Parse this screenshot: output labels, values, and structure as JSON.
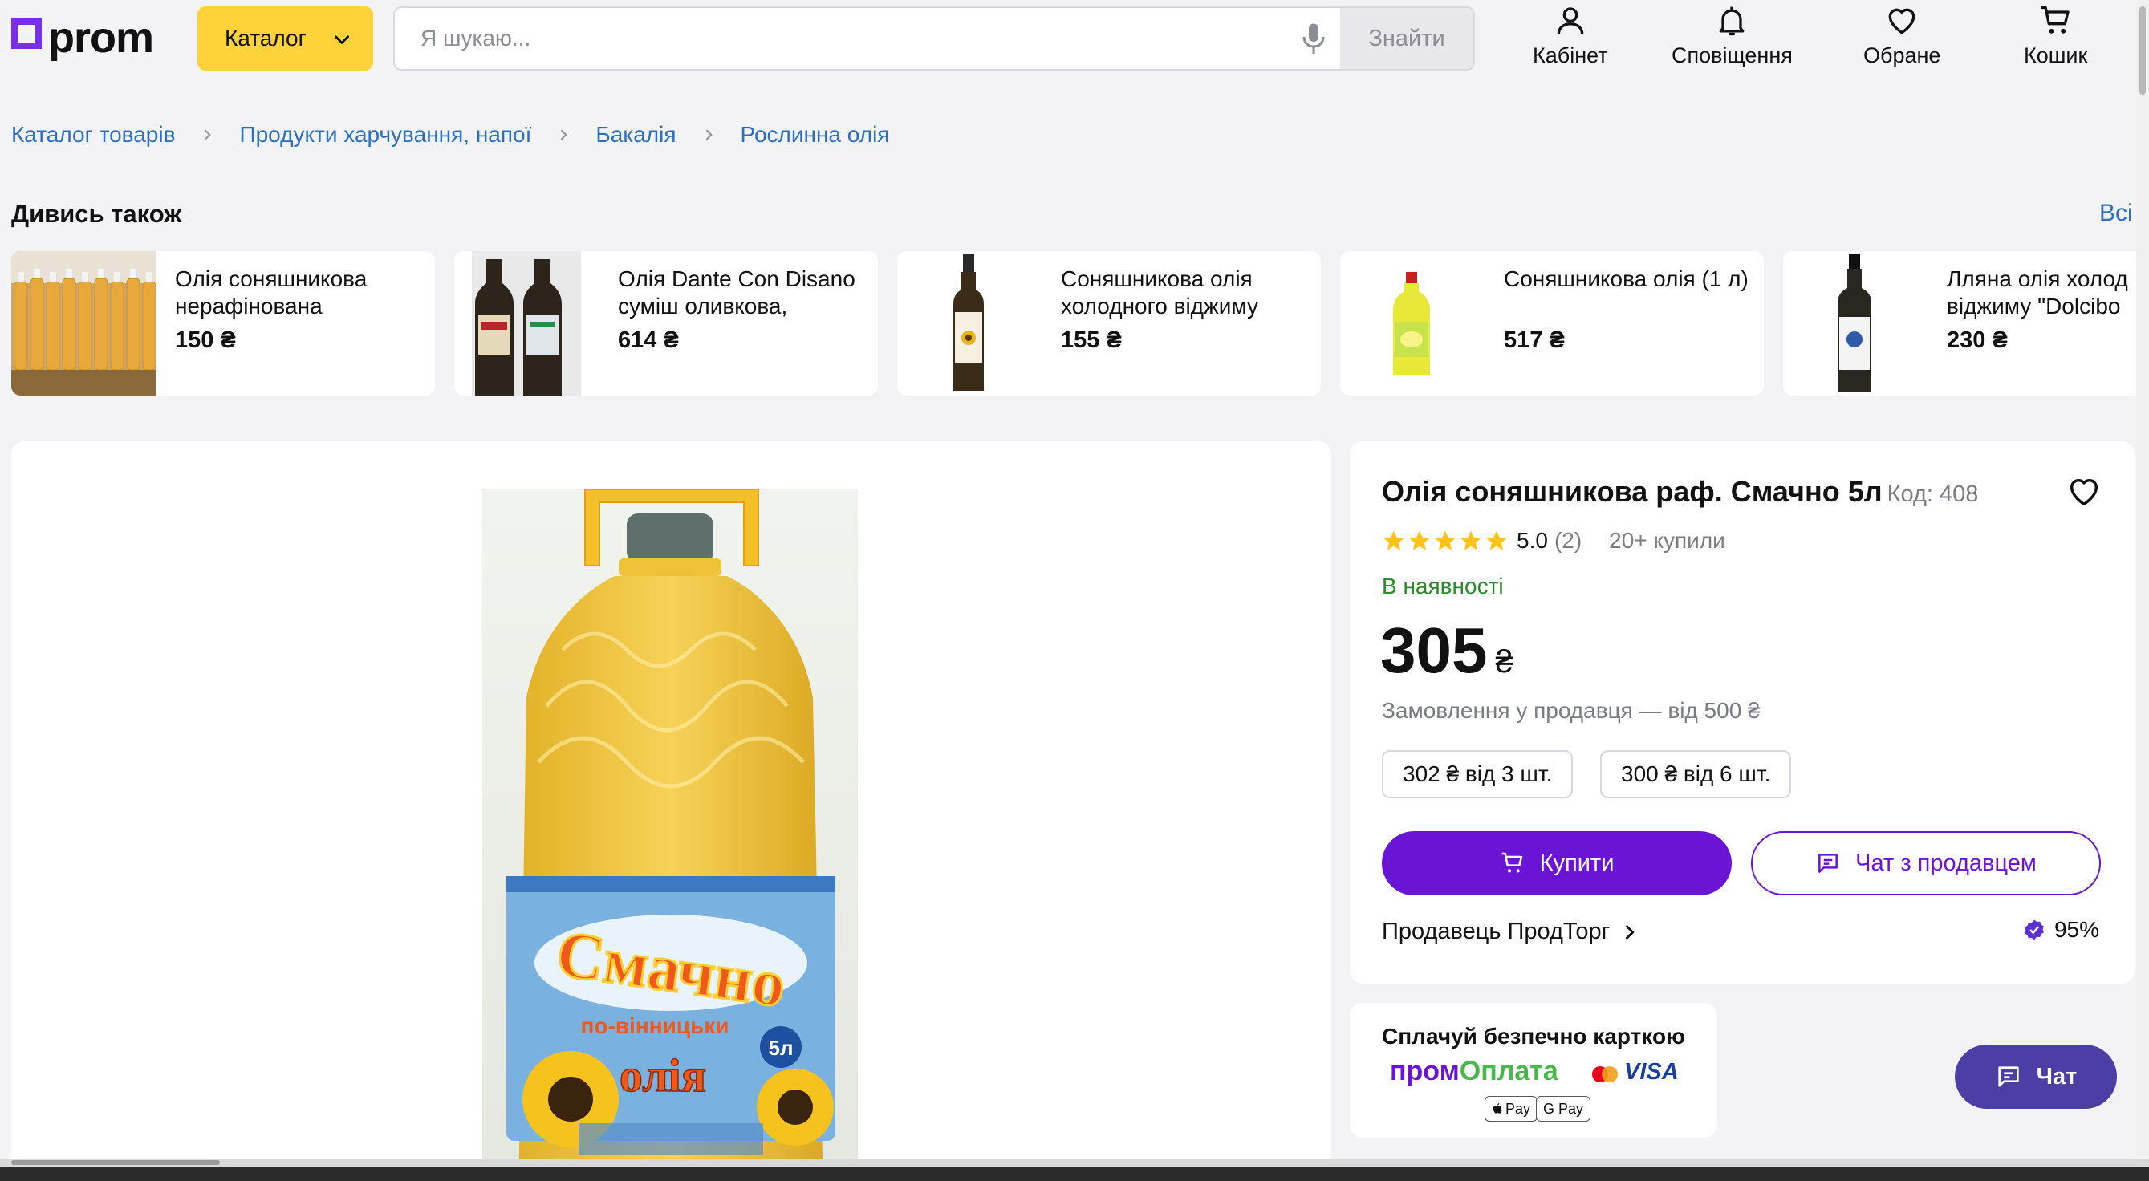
{
  "header": {
    "logo": "prom",
    "catalog_label": "Каталог",
    "search_placeholder": "Я шукаю...",
    "search_button": "Знайти",
    "nav": [
      {
        "label": "Кабінет",
        "icon": "user-icon"
      },
      {
        "label": "Сповіщення",
        "icon": "bell-icon"
      },
      {
        "label": "Обране",
        "icon": "heart-icon"
      },
      {
        "label": "Кошик",
        "icon": "cart-icon"
      }
    ]
  },
  "breadcrumb": [
    "Каталог товарів",
    "Продукти харчування, напої",
    "Бакалія",
    "Рослинна олія"
  ],
  "see_also": {
    "title": "Дивись також",
    "all_link": "Всі",
    "items": [
      {
        "name": "Олія соняшникова нерафінована",
        "price": "150 ₴"
      },
      {
        "name": "Олія Dante Con Disano суміш оливкова,",
        "price": "614 ₴"
      },
      {
        "name": "Соняшникова олія холодного віджиму",
        "price": "155 ₴"
      },
      {
        "name": "Соняшникова олія (1 л)",
        "price": "517 ₴"
      },
      {
        "name": "Лляна олія холод віджиму \"Dolcibo",
        "price": "230 ₴"
      }
    ]
  },
  "product": {
    "title": "Олія соняшникова раф. Смачно 5л",
    "code": "Код: 408",
    "rating": "5.0",
    "rating_count": "(2)",
    "bought": "20+ купили",
    "availability": "В наявності",
    "price": "305",
    "currency": "₴",
    "min_order": "Замовлення у продавця — від 500 ₴",
    "tiers": [
      "302 ₴ від 3 шт.",
      "300 ₴ від 6 шт."
    ],
    "buy_label": "Купити",
    "chat_label": "Чат з продавцем",
    "seller": "Продавець ПродТорг",
    "seller_score": "95%",
    "label_text": {
      "brand": "Смачно",
      "region": "по-вінницьки",
      "product": "олія",
      "volume": "5л"
    }
  },
  "payment": {
    "title": "Сплачуй безпечно карткою",
    "brand_part1": "пром",
    "brand_part2": "Оплата",
    "visa": "VISA",
    "apple_pay": "Pay",
    "google_pay": "G Pay"
  },
  "chat_fab": "Чат",
  "colors": {
    "accent": "#6a14d6",
    "catalog_yellow": "#fdd339",
    "link_blue": "#2b6fc2",
    "in_stock_green": "#2b8a2b"
  }
}
